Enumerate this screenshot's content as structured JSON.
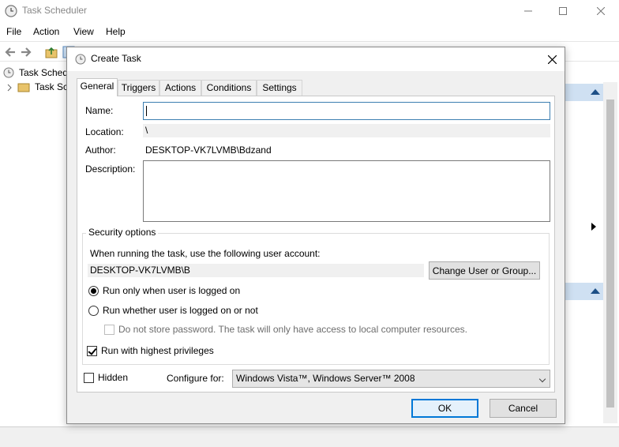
{
  "app": {
    "title": "Task Scheduler",
    "menu": [
      "File",
      "Action",
      "View",
      "Help"
    ],
    "tree": [
      {
        "label": "Task Schedu"
      },
      {
        "label": "Task Sche"
      }
    ]
  },
  "dialog": {
    "title": "Create Task",
    "tabs": [
      "General",
      "Triggers",
      "Actions",
      "Conditions",
      "Settings"
    ],
    "active_tab": "General",
    "general": {
      "name_label": "Name:",
      "name_value": "",
      "location_label": "Location:",
      "location_value": "\\",
      "author_label": "Author:",
      "author_value": "DESKTOP-VK7LVMB\\Bdzand",
      "description_label": "Description:",
      "description_value": "",
      "security": {
        "caption": "Security options",
        "account_prompt": "When running the task, use the following user account:",
        "account_value": "DESKTOP-VK7LVMB\\B",
        "change_user_button": "Change User or Group...",
        "run_logged_on_label": "Run only when user is logged on",
        "run_logged_on_checked": true,
        "run_whether_label": "Run whether user is logged on or not",
        "run_whether_checked": false,
        "no_store_password_label": "Do not store password.  The task will only have access to local computer resources.",
        "no_store_password_checked": false,
        "highest_privileges_label": "Run with highest privileges",
        "highest_privileges_checked": true
      },
      "hidden_label": "Hidden",
      "hidden_checked": false,
      "configure_for_label": "Configure for:",
      "configure_for_value": "Windows Vista™, Windows Server™ 2008"
    },
    "ok_button": "OK",
    "cancel_button": "Cancel"
  },
  "colors": {
    "accent": "#0078d7",
    "pane_header": "#cfe0f2"
  }
}
